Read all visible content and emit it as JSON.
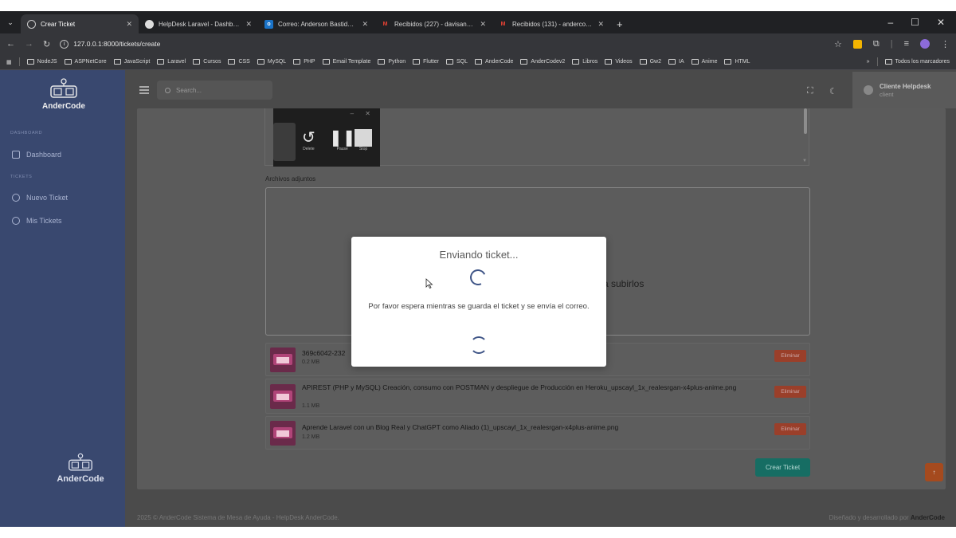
{
  "browser": {
    "tabs": [
      {
        "title": "Crear Ticket",
        "active": true,
        "icon": "globe-icon"
      },
      {
        "title": "HelpDesk Laravel - Dashboard",
        "active": false,
        "icon": "circle-icon"
      },
      {
        "title": "Correo: Anderson Bastidas - Ou",
        "active": false,
        "icon": "outlook-icon"
      },
      {
        "title": "Recibidos (227) - davisanderson",
        "active": false,
        "icon": "gmail-icon"
      },
      {
        "title": "Recibidos (131) - andercode87",
        "active": false,
        "icon": "gmail-icon"
      }
    ],
    "url": "127.0.0.1:8000/tickets/create",
    "bookmarks": [
      "NodeJS",
      "ASPNetCore",
      "JavaScript",
      "Laravel",
      "Cursos",
      "CSS",
      "MySQL",
      "PHP",
      "Email Template",
      "Python",
      "Flutter",
      "SQL",
      "AnderCode",
      "AnderCodev2",
      "Libros",
      "Videos",
      "Gw2",
      "IA",
      "Anime",
      "HTML"
    ],
    "all_bookmarks": "Todos los marcadores",
    "overflow": "»"
  },
  "sidebar": {
    "brand": "AnderCode",
    "section_dashboard": "DASHBOARD",
    "dashboard": "Dashboard",
    "section_tickets": "TICKETS",
    "nuevo_ticket": "Nuevo Ticket",
    "mis_tickets": "Mis Tickets",
    "brand_bottom": "AnderCode"
  },
  "topnav": {
    "search_placeholder": "Search...",
    "user_name": "Cliente Helpdesk",
    "user_role": "client"
  },
  "recorder": {
    "delete": "Delete",
    "pause": "Pause",
    "stop": "Stop"
  },
  "form": {
    "attachments_label": "Archivos adjuntos",
    "dropzone_partial_text": "a subirlos",
    "files": [
      {
        "name": "369c6042-232",
        "size": "0.2 MB"
      },
      {
        "name": "APIREST (PHP y MySQL) Creación, consumo con POSTMAN y despliegue de Producción en Heroku_upscayl_1x_realesrgan-x4plus-anime.png",
        "size": "1.1 MB"
      },
      {
        "name": "Aprende Laravel con un Blog Real y ChatGPT como Aliado (1)_upscayl_1x_realesrgan-x4plus-anime.png",
        "size": "1.2 MB"
      }
    ],
    "delete_label": "Eliminar",
    "create_button": "Crear Ticket"
  },
  "footer": {
    "left": "2025 © AnderCode Sistema de Mesa de Ayuda - HelpDesk AnderCode.",
    "right_prefix": "Diseñado y desarrollado por",
    "right_brand": "AnderCode"
  },
  "modal": {
    "title": "Enviando ticket...",
    "message": "Por favor espera mientras se guarda el ticket y se envía el correo."
  },
  "colors": {
    "accent": "#3e5486",
    "sidebar": "#39486f",
    "create_button": "#166d63",
    "delete_button": "#9a3f2a"
  }
}
